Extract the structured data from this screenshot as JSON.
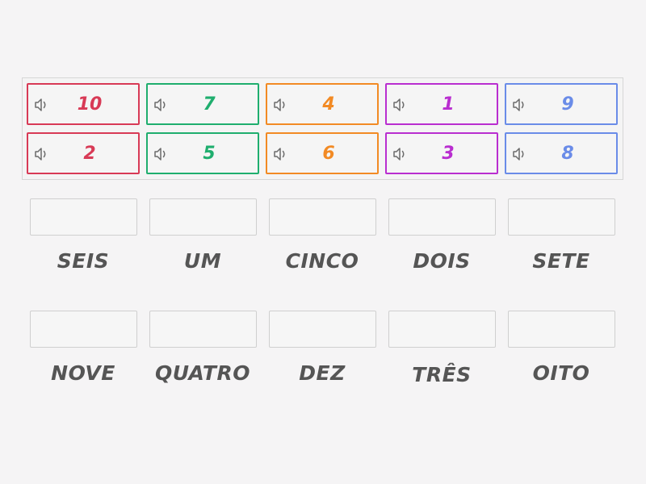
{
  "tray": {
    "tiles": [
      {
        "value": "10",
        "color": "#d83a56",
        "icon": "speaker-icon"
      },
      {
        "value": "7",
        "color": "#1fae6e",
        "icon": "speaker-icon"
      },
      {
        "value": "4",
        "color": "#f28a24",
        "icon": "speaker-icon"
      },
      {
        "value": "1",
        "color": "#b92ed0",
        "icon": "speaker-icon"
      },
      {
        "value": "9",
        "color": "#6a8ce8",
        "icon": "speaker-icon"
      },
      {
        "value": "2",
        "color": "#d83a56",
        "icon": "speaker-icon"
      },
      {
        "value": "5",
        "color": "#1fae6e",
        "icon": "speaker-icon"
      },
      {
        "value": "6",
        "color": "#f28a24",
        "icon": "speaker-icon"
      },
      {
        "value": "3",
        "color": "#b92ed0",
        "icon": "speaker-icon"
      },
      {
        "value": "8",
        "color": "#6a8ce8",
        "icon": "speaker-icon"
      }
    ]
  },
  "targets": [
    {
      "label": "SEIS",
      "answer": ""
    },
    {
      "label": "UM",
      "answer": ""
    },
    {
      "label": "CINCO",
      "answer": ""
    },
    {
      "label": "DOIS",
      "answer": ""
    },
    {
      "label": "SETE",
      "answer": ""
    },
    {
      "label": "NOVE",
      "answer": ""
    },
    {
      "label": "QUATRO",
      "answer": ""
    },
    {
      "label": "DEZ",
      "answer": ""
    },
    {
      "label": "TRÊS",
      "answer": ""
    },
    {
      "label": "OITO",
      "answer": ""
    }
  ]
}
